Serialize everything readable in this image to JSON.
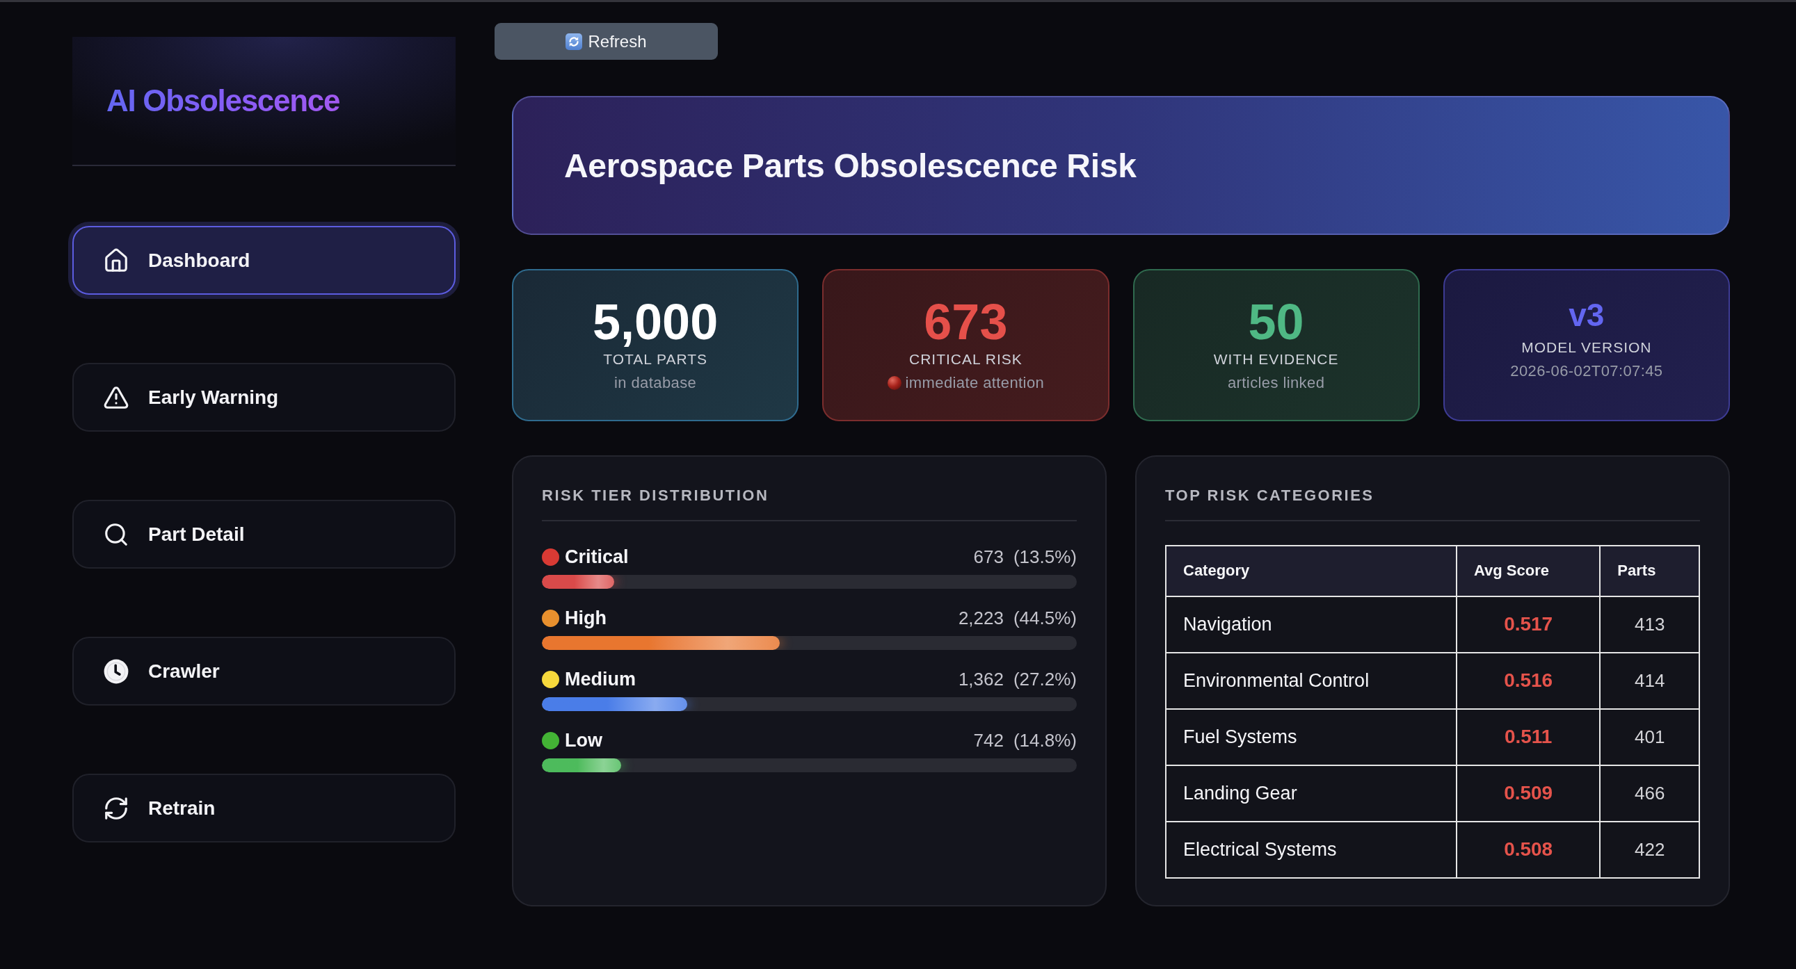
{
  "sidebar": {
    "logo": "AI Obsolescence",
    "nav": [
      {
        "label": "Dashboard",
        "selected": true
      },
      {
        "label": "Early Warning",
        "selected": false
      },
      {
        "label": "Part Detail",
        "selected": false
      },
      {
        "label": "Crawler",
        "selected": false
      },
      {
        "label": "Retrain",
        "selected": false
      }
    ]
  },
  "toolbar": {
    "refresh_button": "Refresh"
  },
  "header": {
    "title": "Aerospace Parts Obsolescence Risk"
  },
  "stats": [
    {
      "kind": "total",
      "value": "5,000",
      "label": "TOTAL PARTS",
      "note": "in database",
      "alert_dot": false
    },
    {
      "kind": "critical",
      "value": "673",
      "label": "CRITICAL RISK",
      "note": "immediate attention",
      "alert_dot": true
    },
    {
      "kind": "evidence",
      "value": "50",
      "label": "WITH EVIDENCE",
      "note": "articles linked",
      "alert_dot": false
    },
    {
      "kind": "version",
      "value": "v3",
      "label": "MODEL VERSION",
      "note": "2026-06-02T07:07:45",
      "alert_dot": false
    }
  ],
  "risk_tiers": {
    "title": "RISK TIER DISTRIBUTION",
    "tiers": [
      {
        "label": "Critical",
        "count": "673",
        "share": "(13.5%)",
        "color": "#d83a34",
        "bar": {
          "color": "#d94a4a",
          "level": 0.135
        }
      },
      {
        "label": "High",
        "count": "2,223",
        "share": "(44.5%)",
        "color": "#e8902e",
        "bar": {
          "color": "#e8762f",
          "level": 0.445
        }
      },
      {
        "label": "Medium",
        "count": "1,362",
        "share": "(27.2%)",
        "color": "#f6d83c",
        "bar": {
          "color": "#4a7de8",
          "level": 0.272
        }
      },
      {
        "label": "Low",
        "count": "742",
        "share": "(14.8%)",
        "color": "#43b335",
        "bar": {
          "color": "#4dbb5c",
          "level": 0.148
        }
      }
    ]
  },
  "top_categories": {
    "title": "TOP RISK CATEGORIES",
    "columns": [
      "Category",
      "Avg Score",
      "Parts"
    ],
    "rows": [
      {
        "category": "Navigation",
        "avg_score": "0.517",
        "parts": "413"
      },
      {
        "category": "Environmental Control",
        "avg_score": "0.516",
        "parts": "414"
      },
      {
        "category": "Fuel Systems",
        "avg_score": "0.511",
        "parts": "401"
      },
      {
        "category": "Landing Gear",
        "avg_score": "0.509",
        "parts": "466"
      },
      {
        "category": "Electrical Systems",
        "avg_score": "0.508",
        "parts": "422"
      }
    ]
  }
}
